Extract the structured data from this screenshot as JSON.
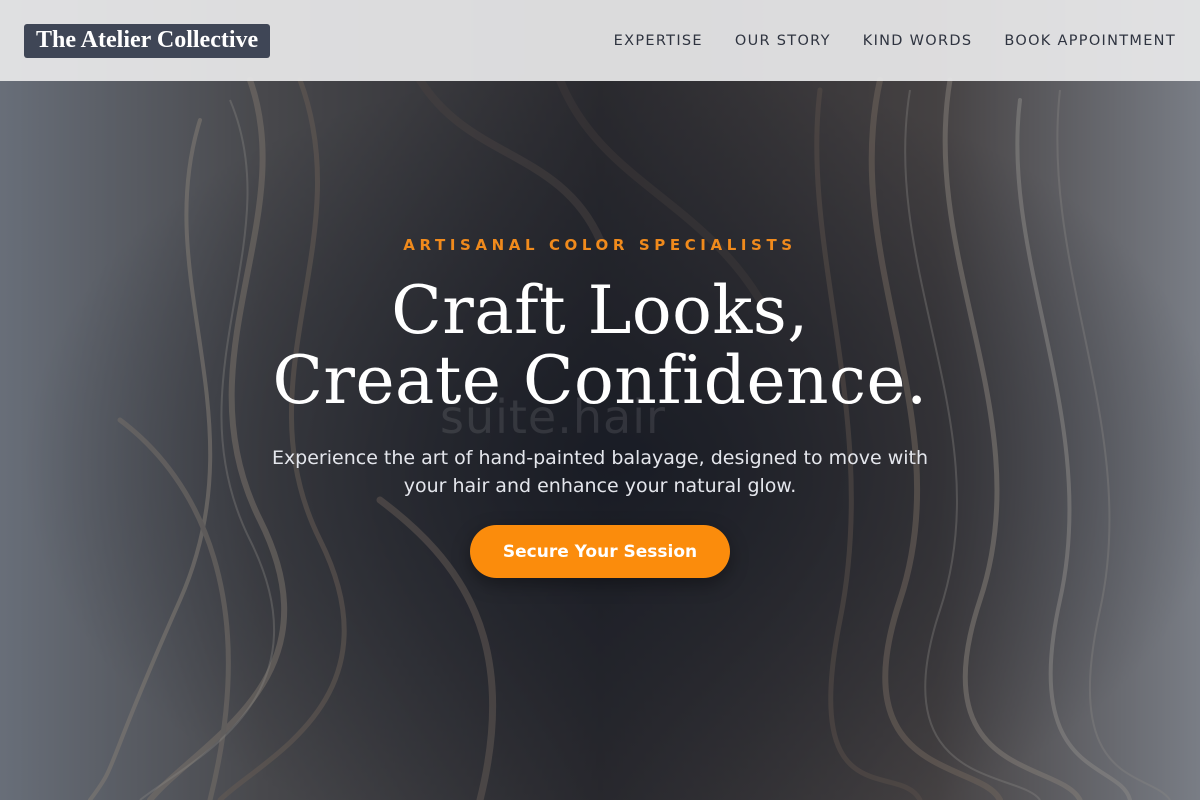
{
  "header": {
    "logo_text": "The Atelier Collective",
    "nav": [
      {
        "label": "EXPERTISE"
      },
      {
        "label": "OUR STORY"
      },
      {
        "label": "KIND WORDS"
      },
      {
        "label": "BOOK APPOINTMENT"
      }
    ]
  },
  "hero": {
    "eyebrow": "ARTISANAL COLOR SPECIALISTS",
    "headline_line1": "Craft Looks,",
    "headline_line2": "Create Confidence.",
    "subtext_line1": "Experience the art of hand-painted balayage, designed to move with",
    "subtext_line2": "your hair and enhance your natural glow.",
    "cta_label": "Secure Your Session",
    "watermark_text": "suite.hair"
  },
  "colors": {
    "accent": "#fb8c0c",
    "eyebrow": "#f08a1c",
    "logo_bg": "#3f4656",
    "header_bg": "#e8e8ea"
  }
}
